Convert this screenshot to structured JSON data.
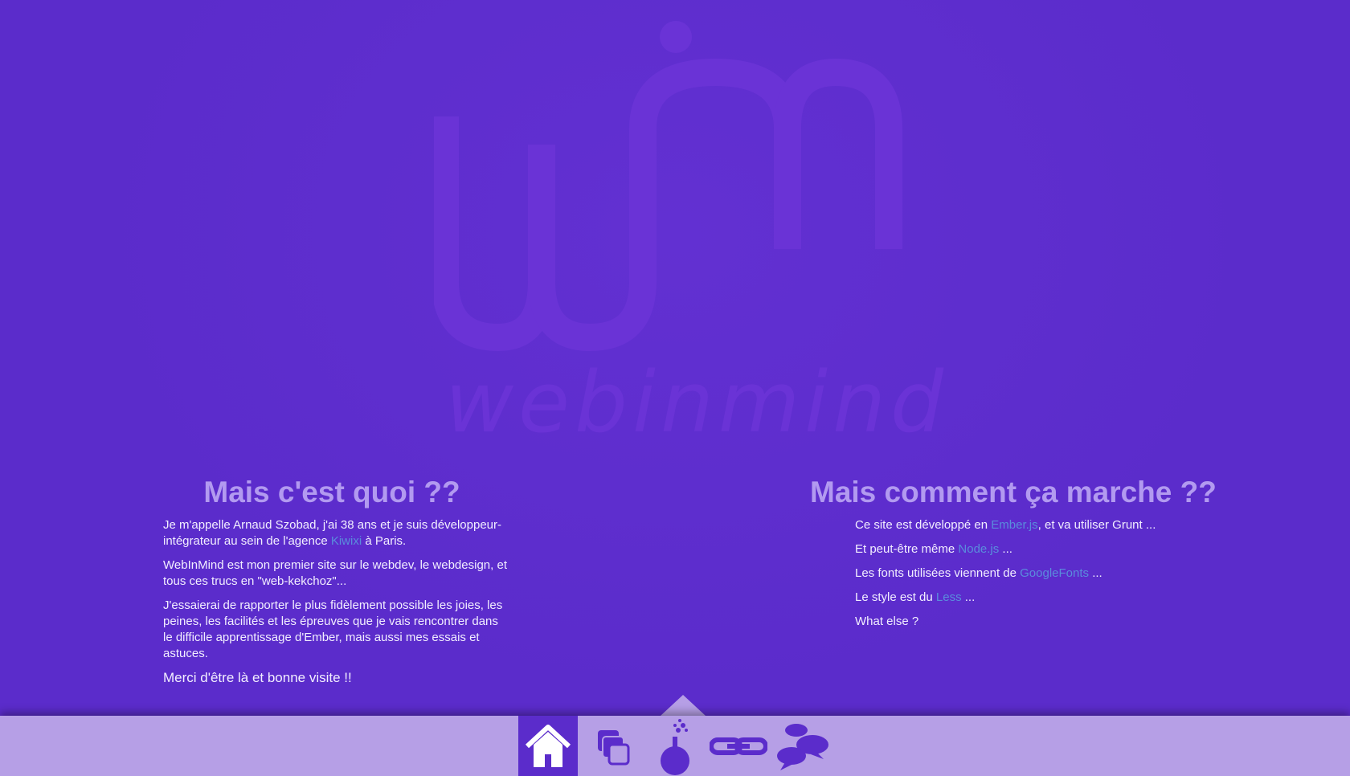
{
  "logo": {
    "wordmark": "webinmind"
  },
  "about": {
    "heading": "Mais c'est quoi ??",
    "p1_before": "Je m'appelle Arnaud Szobad, j'ai 38 ans et je suis développeur-intégrateur au sein de l'agence ",
    "p1_link": "Kiwixi",
    "p1_after": " à Paris.",
    "p2": "WebInMind est mon premier site sur le webdev, le webdesign, et tous ces trucs en \"web-kekchoz\"...",
    "p3": "J'essaierai de rapporter le plus fidèlement possible les joies, les peines, les facilités et les épreuves que je vais rencontrer dans le difficile apprentissage d'Ember, mais aussi mes essais et astuces.",
    "closing": "Merci d'être là et bonne visite !!"
  },
  "how": {
    "heading": "Mais comment ça marche ??",
    "items": [
      {
        "before": "Ce site est développé en ",
        "link": "Ember.js",
        "after": ", et va utiliser Grunt ..."
      },
      {
        "before": "Et peut-être même ",
        "link": "Node.js",
        "after": " ..."
      },
      {
        "before": "Les fonts utilisées viennent de ",
        "link": "GoogleFonts",
        "after": " ..."
      },
      {
        "before": "Le style est du ",
        "link": "Less",
        "after": " ..."
      },
      {
        "before": "What else ?",
        "link": "",
        "after": ""
      }
    ]
  },
  "nav": {
    "items": [
      {
        "icon": "home-icon",
        "active": true
      },
      {
        "icon": "gallery-icon",
        "active": false
      },
      {
        "icon": "lab-flask-icon",
        "active": false
      },
      {
        "icon": "chain-link-icon",
        "active": false
      },
      {
        "icon": "chat-bubbles-icon",
        "active": false
      }
    ]
  },
  "colors": {
    "background": "#5b2ccb",
    "heading": "#b29af0",
    "link": "#5a8cdc",
    "navbar": "#b69fe6",
    "logo": "#6a33d6"
  }
}
